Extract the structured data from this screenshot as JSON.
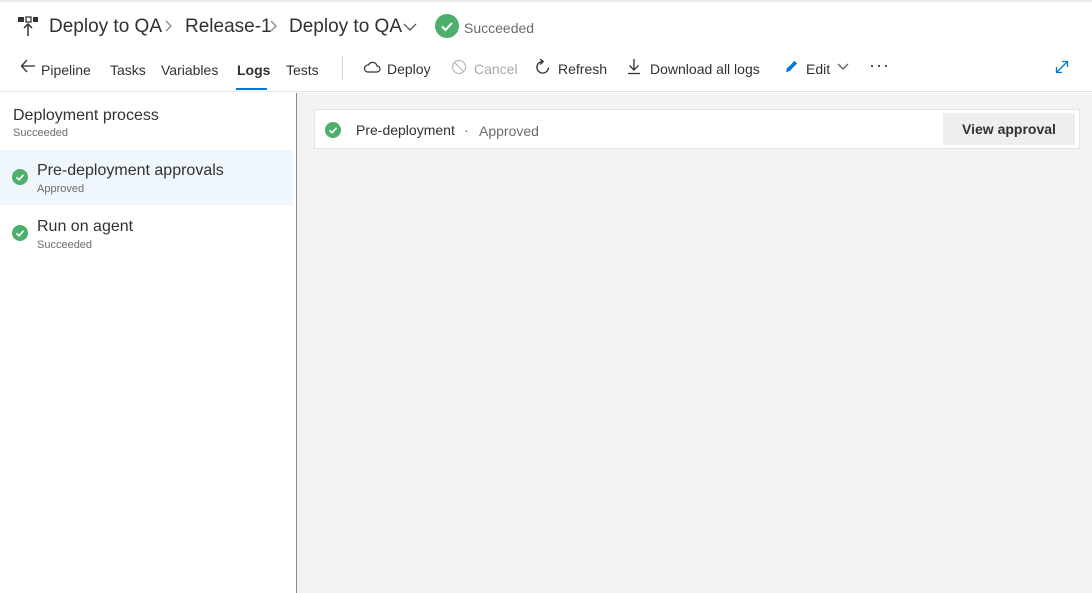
{
  "breadcrumb": {
    "items": [
      "Deploy to QA",
      "Release-1",
      "Deploy to QA"
    ],
    "status": "Succeeded"
  },
  "toolbar": {
    "back_label": "Pipeline",
    "tabs": [
      "Tasks",
      "Variables",
      "Logs",
      "Tests"
    ],
    "active_tab": "Logs",
    "actions": {
      "deploy": "Deploy",
      "cancel": "Cancel",
      "refresh": "Refresh",
      "download": "Download all logs",
      "edit": "Edit",
      "more": "···"
    }
  },
  "left_panel": {
    "title": "Deployment process",
    "subtitle": "Succeeded",
    "items": [
      {
        "name": "Pre-deployment approvals",
        "status": "Approved"
      },
      {
        "name": "Run on agent",
        "status": "Succeeded"
      }
    ]
  },
  "content": {
    "card": {
      "label": "Pre-deployment",
      "separator": "·",
      "state": "Approved",
      "button": "View approval"
    }
  },
  "colors": {
    "accent": "#0078d4",
    "success": "#4caf6b",
    "selected_bg": "#eff6fc",
    "content_bg": "#f3f3f3"
  },
  "icons": [
    "pipeline-icon",
    "chevron-right-icon",
    "chevron-down-icon",
    "check-circle-icon",
    "back-arrow-icon",
    "cloud-icon",
    "cancel-icon",
    "refresh-icon",
    "download-icon",
    "pencil-icon",
    "more-icon",
    "expand-icon"
  ]
}
